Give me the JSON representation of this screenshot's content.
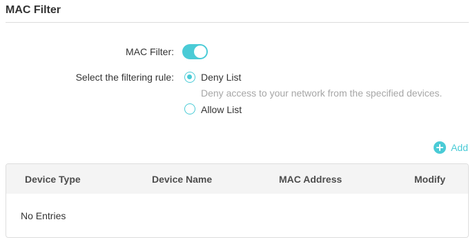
{
  "section": {
    "title": "MAC Filter"
  },
  "form": {
    "mac_filter_label": "MAC Filter:",
    "mac_filter_enabled": true,
    "rule_label": "Select the filtering rule:",
    "rules": [
      {
        "label": "Deny List",
        "selected": true,
        "description": "Deny access to your network from the specified devices."
      },
      {
        "label": "Allow List",
        "selected": false
      }
    ]
  },
  "toolbar": {
    "add_label": "Add",
    "add_icon": "plus-circle-icon"
  },
  "table": {
    "columns": [
      "Device Type",
      "Device Name",
      "MAC Address",
      "Modify"
    ],
    "rows": [],
    "empty_text": "No Entries"
  },
  "colors": {
    "accent": "#4acbd6",
    "text": "#333333",
    "muted": "#a6a6a6",
    "header_bg": "#f4f4f4",
    "border": "#dddddd"
  }
}
